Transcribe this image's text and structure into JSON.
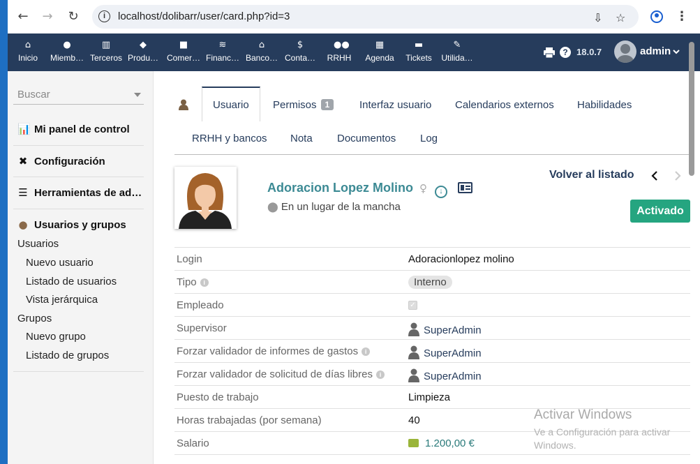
{
  "browser": {
    "url": "localhost/dolibarr/user/card.php?id=3"
  },
  "topmenu": [
    {
      "label": "Inicio",
      "icon": "home-icon"
    },
    {
      "label": "Miemb…",
      "icon": "member-icon"
    },
    {
      "label": "Terceros",
      "icon": "building-icon"
    },
    {
      "label": "Produ…",
      "icon": "cube-icon"
    },
    {
      "label": "Comer…",
      "icon": "briefcase-icon"
    },
    {
      "label": "Financ…",
      "icon": "coins-icon"
    },
    {
      "label": "Banco…",
      "icon": "bank-icon"
    },
    {
      "label": "Conta…",
      "icon": "search-dollar-icon"
    },
    {
      "label": "RRHH",
      "icon": "users-icon"
    },
    {
      "label": "Agenda",
      "icon": "calendar-icon"
    },
    {
      "label": "Tickets",
      "icon": "ticket-icon"
    },
    {
      "label": "Utilida…",
      "icon": "wrench-icon"
    }
  ],
  "header": {
    "version": "18.0.7",
    "user": "admin"
  },
  "sidebar": {
    "search_placeholder": "Buscar",
    "dashboard": "Mi panel de control",
    "config": "Configuración",
    "tools": "Herramientas de ad…",
    "users_groups": "Usuarios y grupos",
    "users": "Usuarios",
    "new_user": "Nuevo usuario",
    "list_users": "Listado de usuarios",
    "hierarchy": "Vista jerárquica",
    "groups": "Grupos",
    "new_group": "Nuevo grupo",
    "list_groups": "Listado de grupos"
  },
  "tabs": {
    "user": "Usuario",
    "perms": "Permisos",
    "perms_count": "1",
    "ui": "Interfaz usuario",
    "calendars": "Calendarios externos",
    "skills": "Habilidades",
    "hr_bank": "RRHH y bancos",
    "note": "Nota",
    "docs": "Documentos",
    "log": "Log"
  },
  "card": {
    "name": "Adoracion Lopez Molino",
    "address": "En un lugar de la mancha",
    "back": "Volver al listado",
    "status": "Activado"
  },
  "fields": {
    "login_k": "Login",
    "login_v": "Adoracionlopez molino",
    "type_k": "Tipo",
    "type_v": "Interno",
    "employee_k": "Empleado",
    "supervisor_k": "Supervisor",
    "supervisor_v": "SuperAdmin",
    "expense_k": "Forzar validador de informes de gastos",
    "expense_v": "SuperAdmin",
    "leave_k": "Forzar validador de solicitud de días libres",
    "leave_v": "SuperAdmin",
    "job_k": "Puesto de trabajo",
    "job_v": "Limpieza",
    "hours_k": "Horas trabajadas (por semana)",
    "hours_v": "40",
    "salary_k": "Salario",
    "salary_v": "1.200,00 €"
  },
  "watermark": {
    "line1": "Activar Windows",
    "line2": "Ve a Configuración para activar Windows."
  }
}
